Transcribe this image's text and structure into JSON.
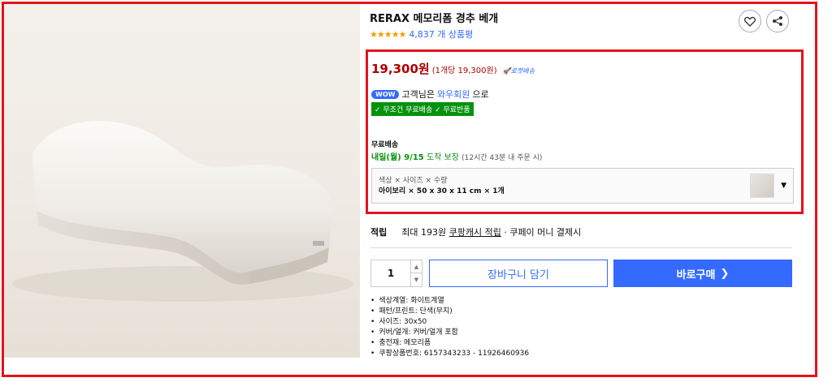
{
  "product": {
    "title": "RERAX 메모리폼 경추 베개",
    "stars": "★★★★★",
    "review_count": "4,837 개 상품평",
    "rating_fraction": 0.9
  },
  "icons": {
    "wishlist": "heart-icon",
    "share": "share-icon"
  },
  "price": {
    "amount": "19,300원",
    "unit_price": "(1개당 19,300원)",
    "delivery_badge": "🚀로켓배송"
  },
  "membership": {
    "badge": "WOW",
    "text_before": "고객님은",
    "link": "와우회원",
    "text_after": "으로",
    "benefits": "✓ 무조건 무료배송 ✓ 무료반품"
  },
  "shipping": {
    "label": "무료배송",
    "arrival_date": "내일(월) 9/15",
    "arrival_text": "도착 보장",
    "deadline": "(12시간 43분 내 주문 시)"
  },
  "option": {
    "label": "색상 × 사이즈 × 수량",
    "value": "아이보리 × 50 x 30 x 11 cm × 1개"
  },
  "points": {
    "label": "적립",
    "text": "최대 193원",
    "link": "쿠팡캐시 적립",
    "suffix": "· 쿠페이 머니 결제시"
  },
  "purchase": {
    "quantity": "1",
    "cart_label": "장바구니 담기",
    "buy_label": "바로구매",
    "buy_arrow": "❯"
  },
  "specs": [
    "색상계열: 화이트계열",
    "패턴/프린트: 단색(무지)",
    "사이즈: 30x50",
    "커버/얼개: 커버/얼개 포함",
    "충전재: 메모리폼",
    "쿠팡상품번호: 6157343233 - 11926460936"
  ],
  "colors": {
    "accent": "#346aff",
    "price": "#ae0000",
    "highlight_border": "#e3141b",
    "green": "#06920d"
  }
}
